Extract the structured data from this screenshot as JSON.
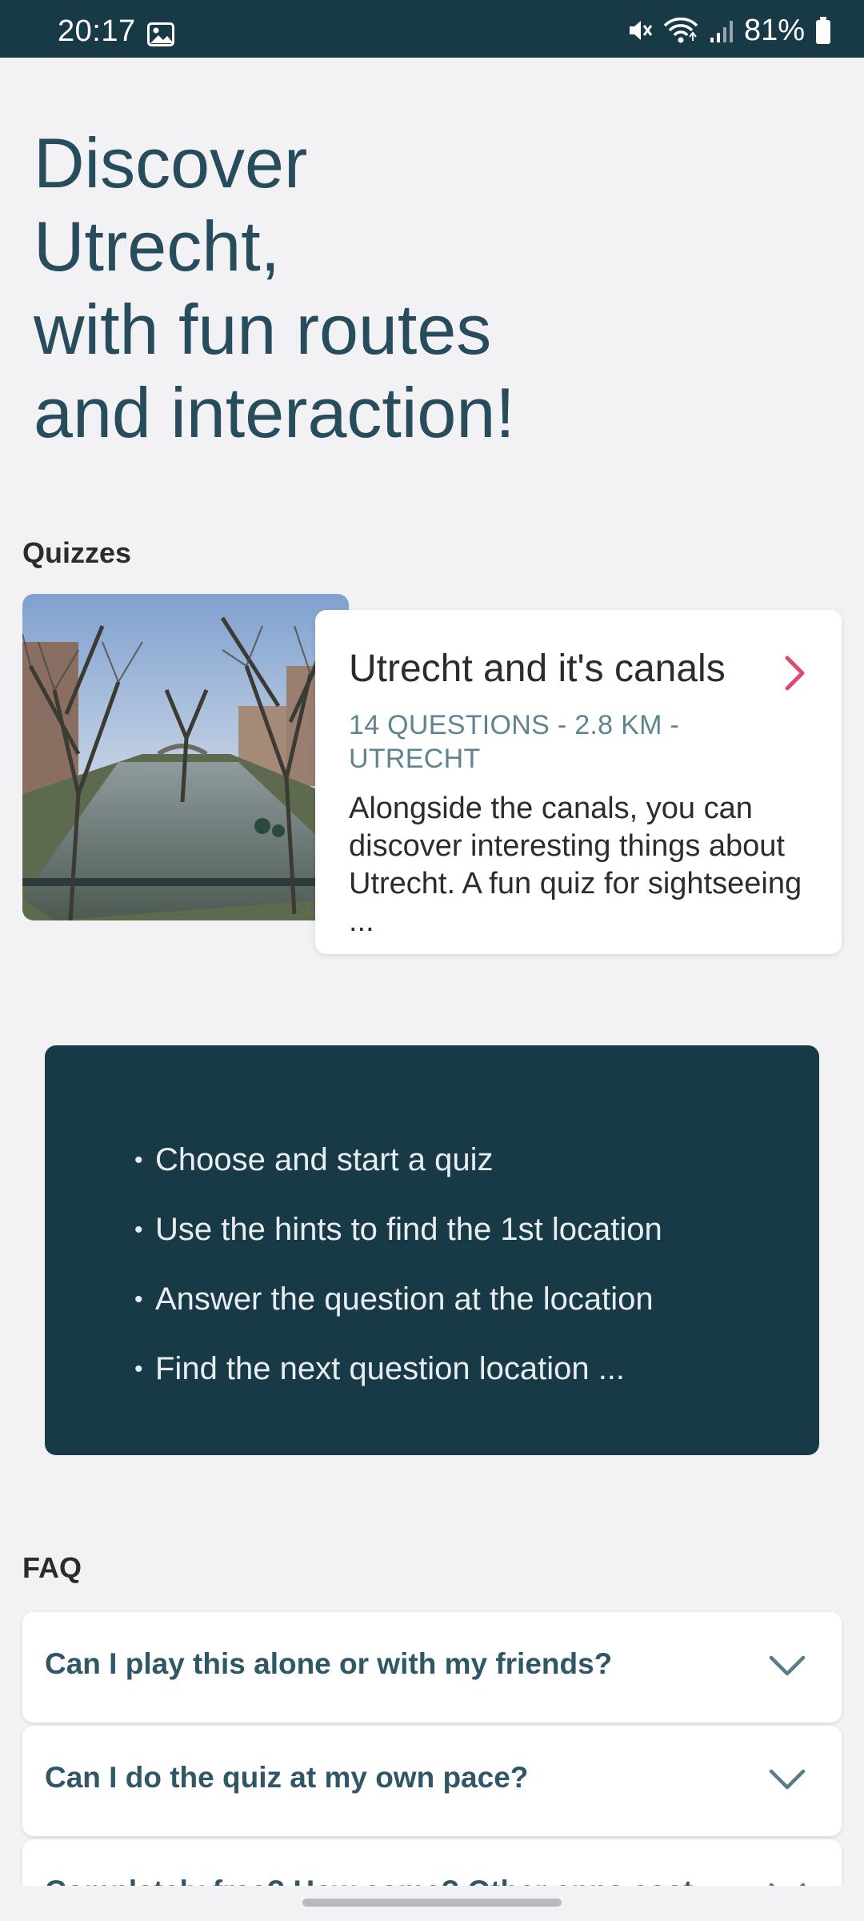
{
  "status_bar": {
    "time": "20:17",
    "battery": "81%",
    "icons": [
      "gallery-icon",
      "mute-icon",
      "wifi-icon",
      "signal-icon",
      "battery-icon"
    ]
  },
  "hero": {
    "lines": [
      "Discover",
      "Utrecht,",
      "with fun routes",
      "and interaction!"
    ]
  },
  "quizzes": {
    "section_title": "Quizzes",
    "items": [
      {
        "title": "Utrecht and it's canals",
        "meta_line1": "14 QUESTIONS - 2.8 KM -",
        "meta_line2": "UTRECHT",
        "description": "Alongside the canals, you can discover interesting things about Utrecht. A fun quiz for sightseeing ..."
      }
    ]
  },
  "steps": {
    "items": [
      "Choose and start a quiz",
      "Use the hints to find the 1st location",
      "Answer the question at the location",
      "Find the next question location ..."
    ]
  },
  "faq": {
    "section_title": "FAQ",
    "items": [
      {
        "question": "Can I play this alone or with my friends?"
      },
      {
        "question": "Can I do the quiz at my own pace?"
      },
      {
        "question": "Completely free? How come? Other apps cost"
      }
    ]
  },
  "colors": {
    "brand_dark": "#183a47",
    "title_text": "#274c5c",
    "accent_chevron": "#e0496c",
    "background": "#f2f2f4"
  }
}
